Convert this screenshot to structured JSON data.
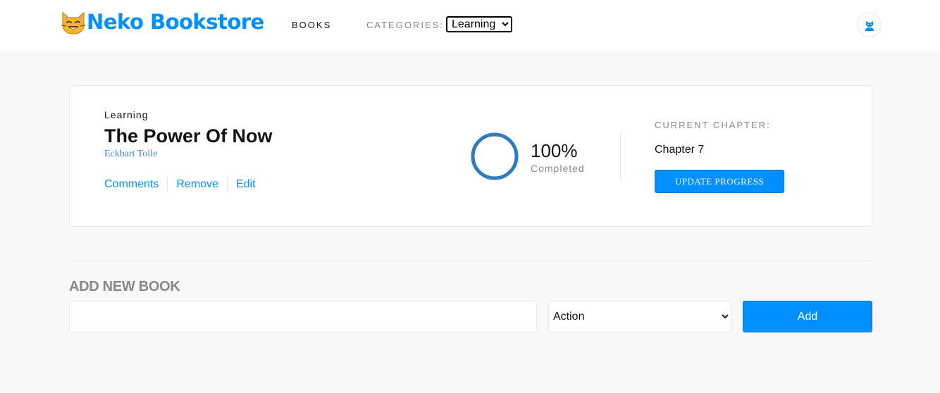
{
  "header": {
    "logo_text": "Neko Bookstore",
    "nav_books": "BOOKS",
    "categories_label": "CATEGORIES:",
    "categories_selected": "Learning",
    "user_icon": "cat-user-icon",
    "logo_icon": "cat-face-icon"
  },
  "book": {
    "genre": "Learning",
    "title": "The Power Of Now",
    "author": "Eckhart Tolle",
    "actions": [
      "Comments",
      "Remove",
      "Edit"
    ],
    "progress_percent": "100%",
    "progress_value": 100,
    "progress_label": "Completed",
    "chapter_label": "CURRENT CHAPTER:",
    "chapter_value": "Chapter 7",
    "update_button": "UPDATE PROGRESS"
  },
  "add_book": {
    "heading": "ADD NEW BOOK",
    "title_value": "",
    "category_selected": "Action",
    "add_button": "Add"
  },
  "colors": {
    "accent": "#0290ff",
    "ring": "#307bbe",
    "background": "#f8f8f8",
    "muted": "#888888"
  }
}
